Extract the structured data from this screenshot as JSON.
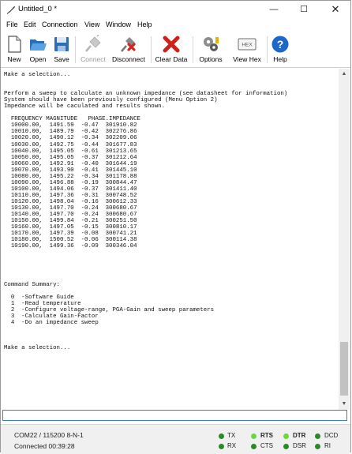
{
  "window": {
    "title": "Untitled_0 *",
    "min_glyph": "—",
    "max_glyph": "☐",
    "close_glyph": "✕"
  },
  "menu": [
    "File",
    "Edit",
    "Connection",
    "View",
    "Window",
    "Help"
  ],
  "toolbar": {
    "new": "New",
    "open": "Open",
    "save": "Save",
    "connect": "Connect",
    "disconnect": "Disconnect",
    "clear_data": "Clear Data",
    "options": "Options",
    "view_hex": "View Hex",
    "hex_icon_text": "HEX",
    "help": "Help"
  },
  "terminal": {
    "text": "Make a selection...\n\n\nPerform a sweep to calculate an unknown impedance (see datasheet for information)\nSystem should have been previously configured (Menu Option 2)\nImpedance will be caculated and results shown.\n\n  FREQUENCY MAGNITUDE   PHASE.IMPEDANCE\n  10000.00,  1491.59  -0.47  301910.82\n  10010.00,  1489.79  -0.42  302276.86\n  10020.00,  1490.12  -0.34  302209.06\n  10030.00,  1492.75  -0.44  301677.83\n  10040.00,  1495.05  -0.61  301213.65\n  10050.00,  1495.05  -0.37  301212.64\n  10060.00,  1492.91  -0.40  301644.19\n  10070.00,  1493.90  -0.41  301445.10\n  10080.00,  1495.22  -0.34  301178.88\n  10090.00,  1496.88  -0.19  300844.47\n  10100.00,  1494.06  -0.37  301411.40\n  10110.00,  1497.36  -0.31  300748.52\n  10120.00,  1498.04  -0.16  300612.33\n  10130.00,  1497.70  -0.24  300680.67\n  10140.00,  1497.70  -0.24  300680.67\n  10150.00,  1499.84  -0.21  300251.50\n  10160.00,  1497.05  -0.15  300810.17\n  10170.00,  1497.39  -0.08  300741.21\n  10180.00,  1500.52  -0.06  300114.38\n  10190.00,  1499.36  -0.09  300346.04\n\n\n\n\n\nCommand Summary:\n\n  0  -Software Guide\n  1  -Read temperature\n  2  -Configure voltage-range, PGA-Gain and sweep parameters\n  3  -Calculate Gain-Factor\n  4  -Do an impedance sweep\n\n\n\nMake a selection..."
  },
  "input": {
    "value": ""
  },
  "scrollbar": {
    "up": "▲",
    "down": "▼"
  },
  "status": {
    "port": "COM22 / 115200 8-N-1",
    "connected": "Connected 00:39:28",
    "leds": {
      "tx": "TX",
      "rx": "RX",
      "rts": "RTS",
      "cts": "CTS",
      "dtr": "DTR",
      "dsr": "DSR",
      "dcd": "DCD",
      "ri": "RI"
    }
  },
  "colors": {
    "led_dark": "#2a8a2a",
    "led_bright": "#6cd83c",
    "input_border": "#3a7ad6"
  }
}
